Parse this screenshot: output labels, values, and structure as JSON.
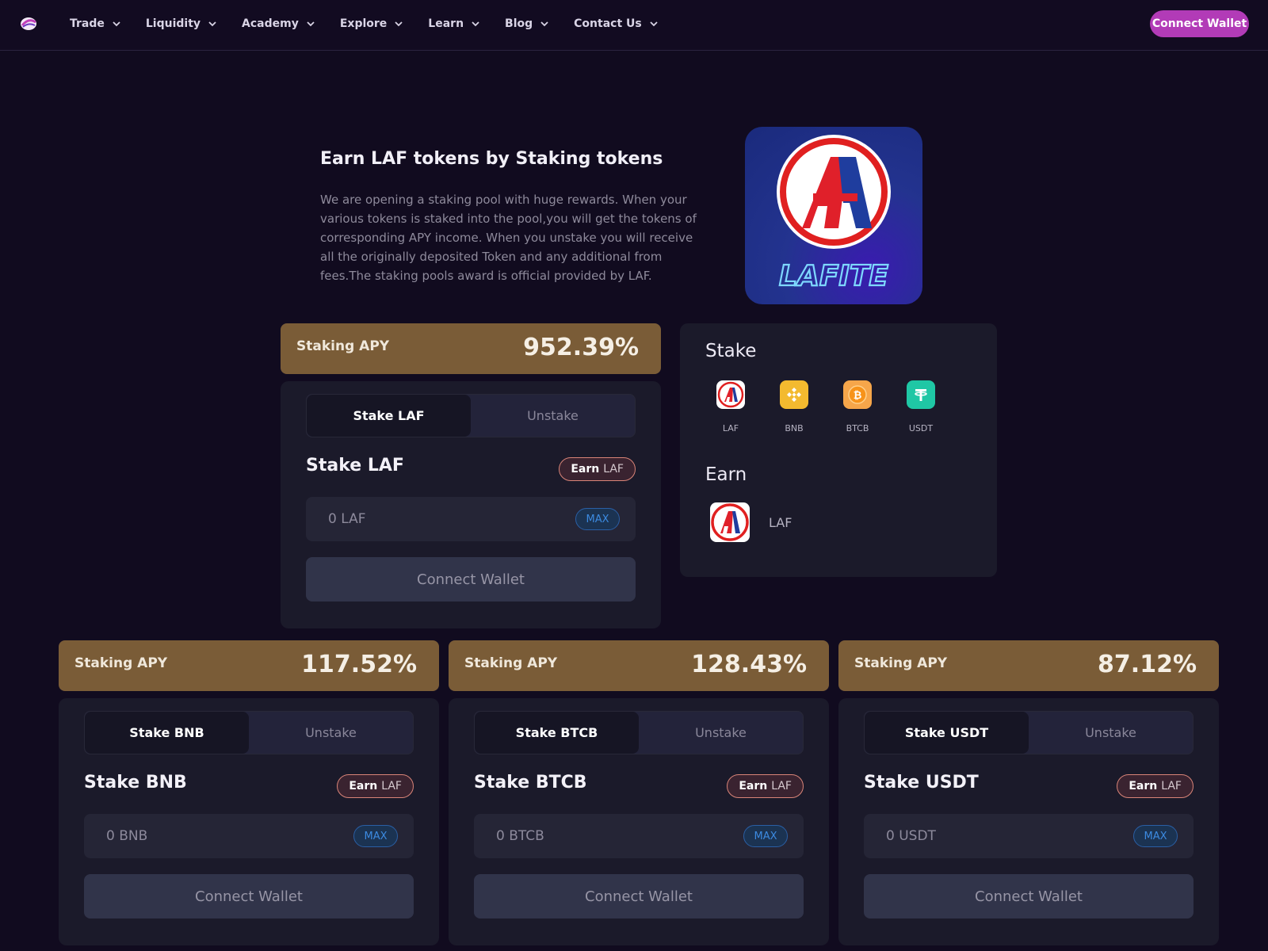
{
  "nav": {
    "items": [
      "Trade",
      "Liquidity",
      "Academy",
      "Explore",
      "Learn",
      "Blog",
      "Contact Us"
    ],
    "connect_label": "Connect Wallet"
  },
  "hero": {
    "title": "Earn LAF tokens by Staking tokens",
    "description": "We are opening a staking pool with huge rewards. When your various tokens is staked into the pool,you will get the tokens of corresponding APY income. When you unstake you will receive all the originally deposited Token and any additional from fees.The staking pools award is official provided by LAF.",
    "logo_text": "LAFITE"
  },
  "pools": [
    {
      "apy_label": "Staking APY",
      "apy_value": "952.39%",
      "tab_stake": "Stake LAF",
      "tab_unstake": "Unstake",
      "heading": "Stake LAF",
      "earn_word": "Earn",
      "earn_token": "LAF",
      "amount": "0 LAF",
      "max_label": "MAX",
      "connect_label": "Connect Wallet"
    },
    {
      "apy_label": "Staking APY",
      "apy_value": "117.52%",
      "tab_stake": "Stake BNB",
      "tab_unstake": "Unstake",
      "heading": "Stake BNB",
      "earn_word": "Earn",
      "earn_token": "LAF",
      "amount": "0 BNB",
      "max_label": "MAX",
      "connect_label": "Connect Wallet"
    },
    {
      "apy_label": "Staking APY",
      "apy_value": "128.43%",
      "tab_stake": "Stake BTCB",
      "tab_unstake": "Unstake",
      "heading": "Stake BTCB",
      "earn_word": "Earn",
      "earn_token": "LAF",
      "amount": "0 BTCB",
      "max_label": "MAX",
      "connect_label": "Connect Wallet"
    },
    {
      "apy_label": "Staking APY",
      "apy_value": "87.12%",
      "tab_stake": "Stake USDT",
      "tab_unstake": "Unstake",
      "heading": "Stake USDT",
      "earn_word": "Earn",
      "earn_token": "LAF",
      "amount": "0 USDT",
      "max_label": "MAX",
      "connect_label": "Connect Wallet"
    }
  ],
  "info": {
    "stake_title": "Stake",
    "stake_tokens": [
      "LAF",
      "BNB",
      "BTCB",
      "USDT"
    ],
    "earn_title": "Earn",
    "earn_token": "LAF"
  },
  "colors": {
    "background": "#110b1f",
    "accent": "#b23bb7",
    "apy_bar": "#7a5c37",
    "card": "#1b1a2a",
    "max_blue": "#3c8ae0",
    "bnb": "#f3ba2f",
    "btcb": "#f7931a",
    "usdt": "#26a17b"
  }
}
